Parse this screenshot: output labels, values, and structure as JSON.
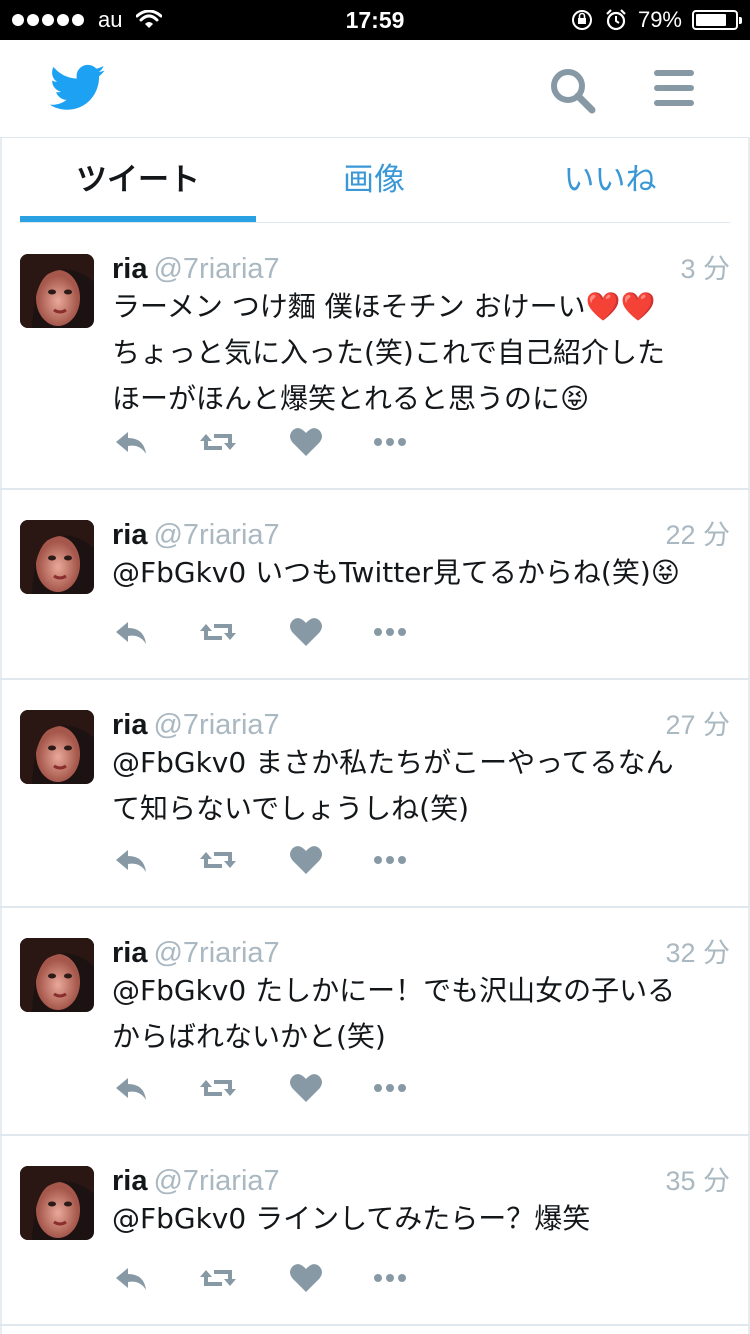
{
  "status_bar": {
    "carrier": "au",
    "time": "17:59",
    "battery": "79%",
    "battery_level": 0.79
  },
  "tabs": [
    {
      "label": "ツイート",
      "selected": true
    },
    {
      "label": "画像",
      "selected": false
    },
    {
      "label": "いいね",
      "selected": false
    }
  ],
  "colors": {
    "accent": "#2aa1e3",
    "tab_inactive": "#3a98d6",
    "muted": "#aab8c2",
    "icon": "#8899a6"
  },
  "tweets": [
    {
      "name": "ria",
      "handle": "@7riaria7",
      "time": "3 分",
      "text": "ラーメン つけ麵 僕ほそチン おけーい❤️❤️\nちょっと気に入った(笑)これで自己紹介した\nほーがほんと爆笑とれると思うのに😝"
    },
    {
      "name": "ria",
      "handle": "@7riaria7",
      "time": "22 分",
      "text": "@FbGkv0 いつもTwitter見てるからね(笑)😝"
    },
    {
      "name": "ria",
      "handle": "@7riaria7",
      "time": "27 分",
      "text": "@FbGkv0 まさか私たちがこーやってるなん\nて知らないでしょうしね(笑)"
    },
    {
      "name": "ria",
      "handle": "@7riaria7",
      "time": "32 分",
      "text": "@FbGkv0 たしかにー！でも沢山女の子いる\nからばれないかと(笑)"
    },
    {
      "name": "ria",
      "handle": "@7riaria7",
      "time": "35 分",
      "text": "@FbGkv0 ラインしてみたらー？爆笑"
    }
  ],
  "icons": [
    "twitter-bird-icon",
    "search-icon",
    "menu-icon",
    "reply-icon",
    "retweet-icon",
    "like-icon",
    "more-icon"
  ]
}
